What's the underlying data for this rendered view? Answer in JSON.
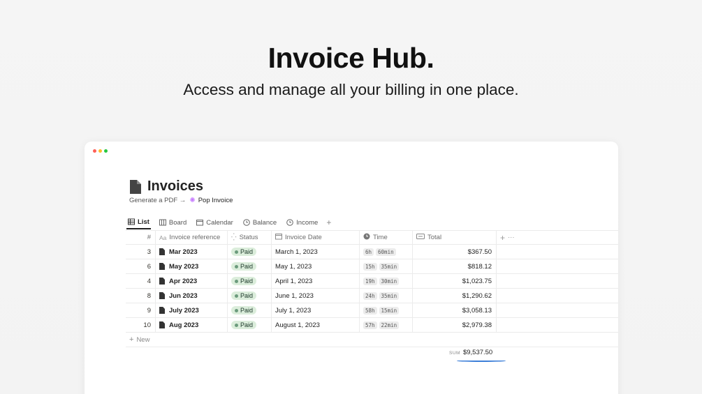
{
  "hero": {
    "title": "Invoice Hub.",
    "subtitle": "Access and manage all your billing in one place."
  },
  "page": {
    "title": "Invoices",
    "generate_label": "Generate a PDF →",
    "link_label": "Pop Invoice"
  },
  "tabs": [
    {
      "label": "List",
      "icon": "table-icon",
      "active": true
    },
    {
      "label": "Board",
      "icon": "board-icon"
    },
    {
      "label": "Calendar",
      "icon": "calendar-icon"
    },
    {
      "label": "Balance",
      "icon": "clock-icon"
    },
    {
      "label": "Income",
      "icon": "clock-icon"
    }
  ],
  "table": {
    "columns": {
      "num": "#",
      "ref_prefix": "Aa",
      "ref": "Invoice reference",
      "status": "Status",
      "date": "Invoice Date",
      "time": "Time",
      "total": "Total"
    },
    "rows": [
      {
        "num": "3",
        "ref": "Mar 2023",
        "status": "Paid",
        "date": "March 1, 2023",
        "hours": "6h",
        "mins": "60min",
        "total": "$367.50"
      },
      {
        "num": "6",
        "ref": "May 2023",
        "status": "Paid",
        "date": "May 1, 2023",
        "hours": "15h",
        "mins": "35min",
        "total": "$818.12"
      },
      {
        "num": "4",
        "ref": "Apr 2023",
        "status": "Paid",
        "date": "April 1, 2023",
        "hours": "19h",
        "mins": "30min",
        "total": "$1,023.75"
      },
      {
        "num": "8",
        "ref": "Jun 2023",
        "status": "Paid",
        "date": "June 1, 2023",
        "hours": "24h",
        "mins": "35min",
        "total": "$1,290.62"
      },
      {
        "num": "9",
        "ref": "July 2023",
        "status": "Paid",
        "date": "July 1, 2023",
        "hours": "58h",
        "mins": "15min",
        "total": "$3,058.13"
      },
      {
        "num": "10",
        "ref": "Aug 2023",
        "status": "Paid",
        "date": "August 1, 2023",
        "hours": "57h",
        "mins": "22min",
        "total": "$2,979.38"
      }
    ],
    "new_label": "New",
    "sum_label": "SUM",
    "sum_value": "$9,537.50"
  },
  "colors": {
    "status_paid_bg": "#dbeddb",
    "accent": "#3b7ed8"
  }
}
